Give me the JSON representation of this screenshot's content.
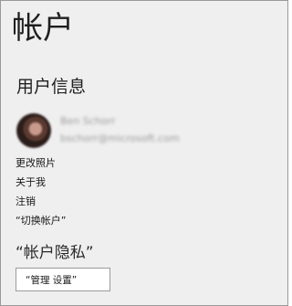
{
  "page": {
    "title": "帐户"
  },
  "user_info": {
    "heading": "用户信息",
    "name": "Ben Schorr",
    "email": "bschorr@microsoft.com"
  },
  "links": [
    {
      "label": "更改照片"
    },
    {
      "label": "关于我"
    },
    {
      "label": "注销"
    },
    {
      "label": "“切换帐户”"
    }
  ],
  "privacy": {
    "heading": "“帐户隐私”",
    "button_label": "“管理 设置”"
  }
}
